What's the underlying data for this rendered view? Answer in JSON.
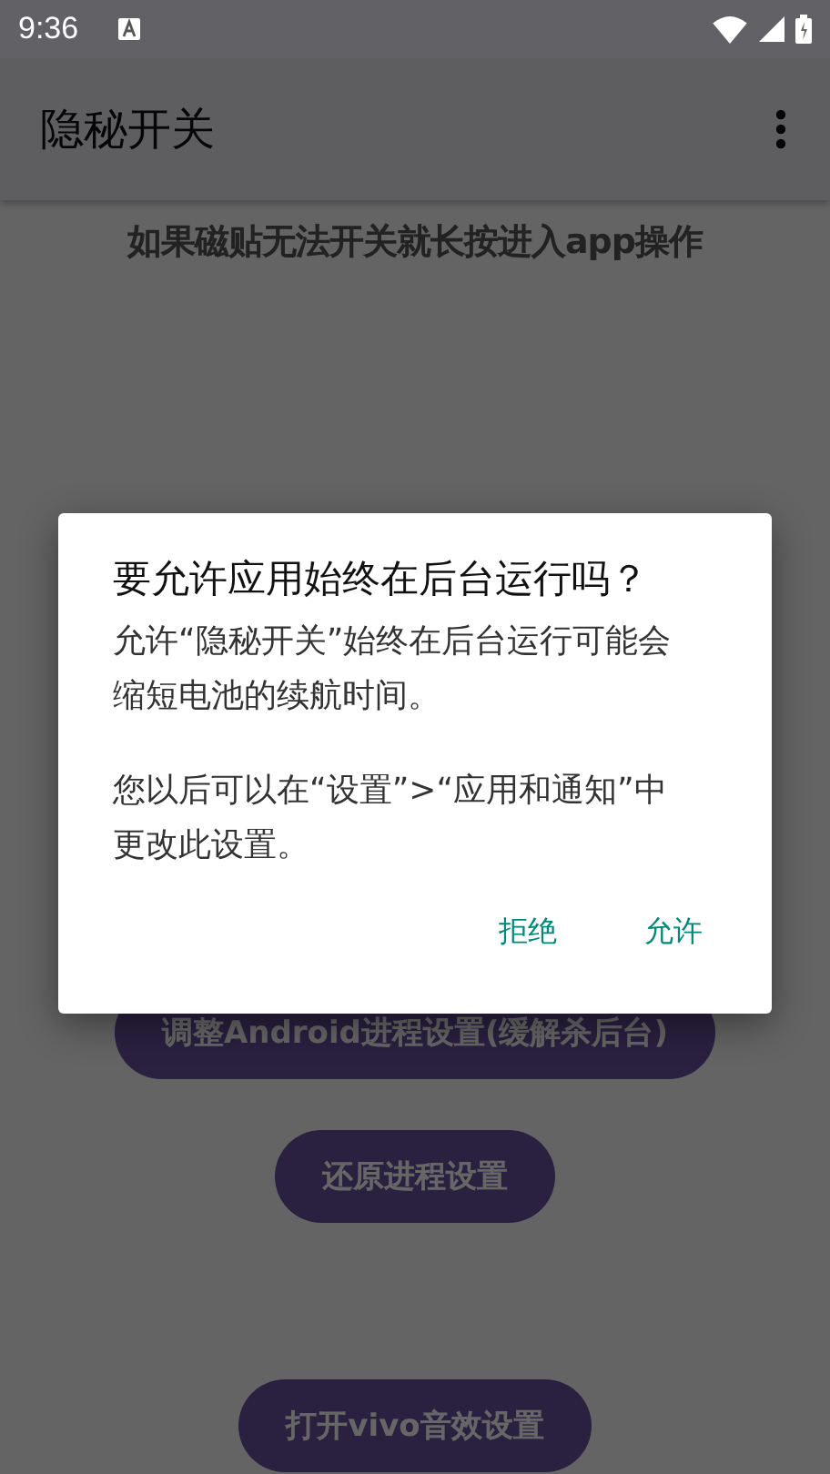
{
  "status_bar": {
    "time": "9:36"
  },
  "app_bar": {
    "title": "隐秘开关"
  },
  "hint": "如果磁贴无法开关就长按进入app操作",
  "buttons": [
    {
      "label": "调整Android进程设置(缓解杀后台)"
    },
    {
      "label": "还原进程设置"
    },
    {
      "label": "打开vivo音效设置"
    }
  ],
  "dialog": {
    "title": "要允许应用始终在后台运行吗？",
    "paragraphs": [
      "允许“隐秘开关”始终在后台运行可能会缩短电池的续航时间。",
      "您以后可以在“设置”>“应用和通知”中更改此设置。"
    ],
    "actions": [
      "拒绝",
      "允许"
    ]
  }
}
